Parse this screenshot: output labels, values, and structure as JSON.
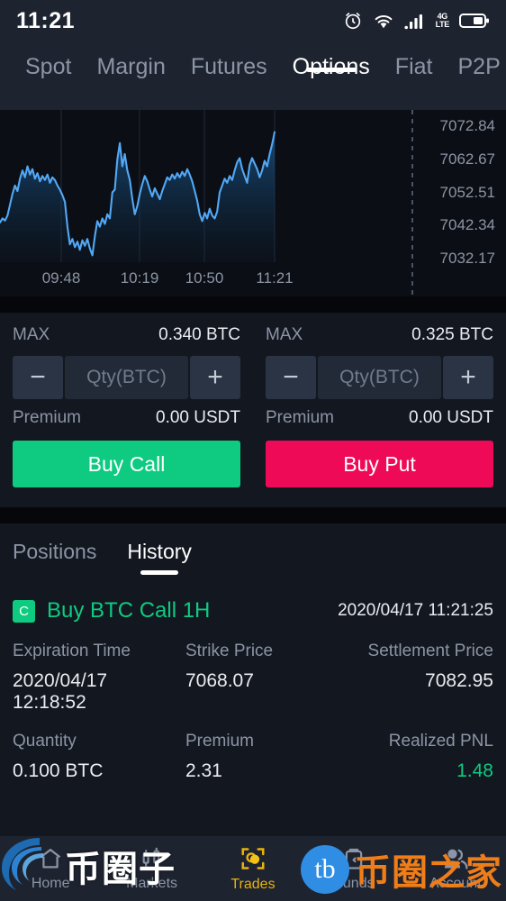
{
  "status_bar": {
    "time": "11:21",
    "network_label": "4G",
    "network_sub": "LTE",
    "icons": [
      "alarm-clock-icon",
      "wifi-icon",
      "signal-bars-icon",
      "lte-icon",
      "battery-icon"
    ]
  },
  "top_nav": {
    "items": [
      {
        "label": "Spot",
        "active": false
      },
      {
        "label": "Margin",
        "active": false
      },
      {
        "label": "Futures",
        "active": false
      },
      {
        "label": "Options",
        "active": true
      },
      {
        "label": "Fiat",
        "active": false
      },
      {
        "label": "P2P",
        "active": false
      }
    ]
  },
  "chart_data": {
    "type": "line",
    "title": "",
    "xlabel": "",
    "ylabel": "",
    "grid": true,
    "legend_position": "none",
    "x_ticks": [
      "09:48",
      "10:19",
      "10:50",
      "11:21"
    ],
    "x_tick_positions": [
      68,
      155,
      227,
      305
    ],
    "y_ticks": [
      "7072.84",
      "7062.67",
      "7052.51",
      "7042.34",
      "7032.17"
    ],
    "ylim": [
      7027.0,
      7078.0
    ],
    "line_color": "#52a8f5",
    "fill_color": "#153a5c",
    "last_price": 7072.84,
    "values": [
      7041.5,
      7043.0,
      7042.2,
      7044.0,
      7048.0,
      7052.0,
      7055.0,
      7053.0,
      7057.5,
      7060.5,
      7058.0,
      7062.0,
      7059.0,
      7061.0,
      7057.5,
      7059.5,
      7056.5,
      7058.5,
      7057.0,
      7059.0,
      7056.0,
      7058.0,
      7057.0,
      7055.0,
      7053.5,
      7051.5,
      7049.0,
      7040.0,
      7033.5,
      7035.5,
      7032.5,
      7034.5,
      7031.5,
      7035.0,
      7033.0,
      7035.5,
      7032.0,
      7029.5,
      7036.5,
      7042.0,
      7040.0,
      7043.0,
      7041.0,
      7044.5,
      7043.0,
      7052.5,
      7053.5,
      7064.5,
      7070.5,
      7062.0,
      7066.5,
      7060.5,
      7057.0,
      7050.0,
      7044.5,
      7047.5,
      7052.0,
      7055.5,
      7058.5,
      7056.5,
      7053.5,
      7051.0,
      7054.0,
      7052.0,
      7050.0,
      7053.0,
      7055.5,
      7058.0,
      7057.0,
      7059.0,
      7057.5,
      7059.5,
      7058.0,
      7060.0,
      7058.5,
      7061.0,
      7059.0,
      7056.5,
      7053.0,
      7049.5,
      7044.5,
      7042.0,
      7045.0,
      7043.0,
      7046.5,
      7044.0,
      7043.0,
      7045.5,
      7052.5,
      7055.0,
      7057.5,
      7056.0,
      7058.5,
      7057.0,
      7060.5,
      7063.5,
      7065.0,
      7061.0,
      7058.5,
      7056.0,
      7062.5,
      7065.0,
      7063.0,
      7061.0,
      7058.0,
      7060.5,
      7064.0,
      7062.0,
      7066.5,
      7070.0,
      7074.5
    ]
  },
  "trade_panel": {
    "call": {
      "max_label": "MAX",
      "max_value": "0.340 BTC",
      "decrement_label": "−",
      "increment_label": "+",
      "qty_placeholder": "Qty(BTC)",
      "qty_value": "",
      "premium_label": "Premium",
      "premium_value": "0.00 USDT",
      "action_label": "Buy Call",
      "action_color": "#0ecb81"
    },
    "put": {
      "max_label": "MAX",
      "max_value": "0.325 BTC",
      "decrement_label": "−",
      "increment_label": "+",
      "qty_placeholder": "Qty(BTC)",
      "qty_value": "",
      "premium_label": "Premium",
      "premium_value": "0.00 USDT",
      "action_label": "Buy Put",
      "action_color": "#ef0a58"
    }
  },
  "positions_section": {
    "tabs": [
      {
        "label": "Positions",
        "active": false
      },
      {
        "label": "History",
        "active": true
      }
    ],
    "record": {
      "badge": "C",
      "title": "Buy BTC Call 1H",
      "timestamp": "2020/04/17 11:21:25",
      "fields": [
        {
          "header": "Expiration Time",
          "value": "2020/04/17 12:18:52"
        },
        {
          "header": "Strike Price",
          "value": "7068.07"
        },
        {
          "header": "Settlement Price",
          "value": "7082.95"
        },
        {
          "header": "Quantity",
          "value": "0.100 BTC"
        },
        {
          "header": "Premium",
          "value": "2.31"
        },
        {
          "header": "Realized PNL",
          "value": "1.48"
        }
      ]
    }
  },
  "bottom_nav": {
    "items": [
      {
        "label": "Home",
        "icon": "home-icon",
        "active": false
      },
      {
        "label": "Markets",
        "icon": "markets-chart-icon",
        "active": false
      },
      {
        "label": "Trades",
        "icon": "trades-icon",
        "active": true
      },
      {
        "label": "Funds",
        "icon": "funds-wallet-icon",
        "active": false
      },
      {
        "label": "Account",
        "icon": "account-user-icon",
        "active": false
      }
    ],
    "active_color": "#e8b30b"
  },
  "watermarks": {
    "left": {
      "text": "币圈子",
      "logo": "blue-swirl-logo"
    },
    "right": {
      "badge_text": "tb",
      "text": "币圈之家",
      "color": "#ef7d18"
    }
  }
}
